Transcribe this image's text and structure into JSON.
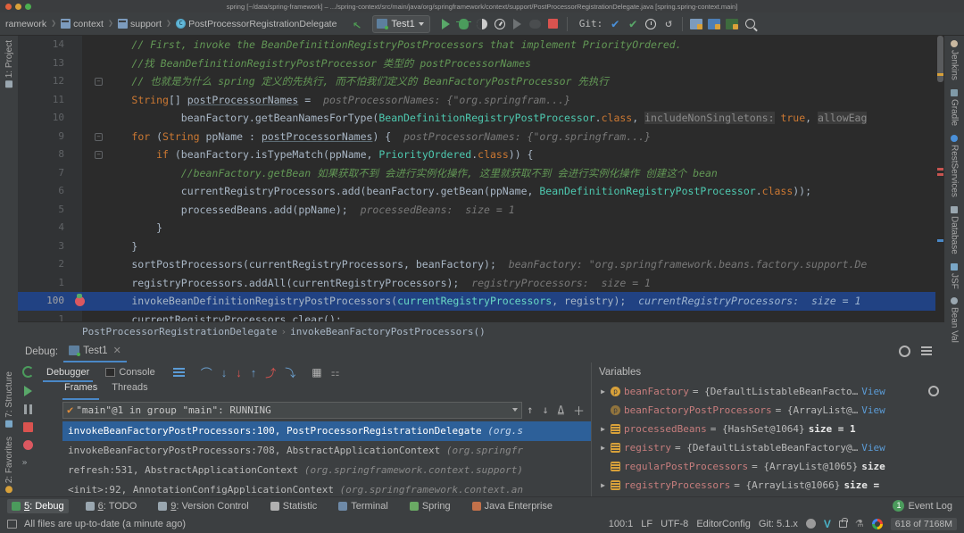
{
  "window": {
    "title": "spring [~/data/spring-framework] – .../spring-context/src/main/java/org/springframework/context/support/PostProcessorRegistrationDelegate.java [spring.spring-context.main]"
  },
  "toolbar": {
    "breadcrumbs": [
      {
        "label": "ramework",
        "icon": ""
      },
      {
        "label": "context",
        "icon": "folder-icon"
      },
      {
        "label": "support",
        "icon": "folder-icon"
      },
      {
        "label": "PostProcessorRegistrationDelegate",
        "icon": "class-icon"
      }
    ],
    "run_config": "Test1",
    "git_label": "Git:"
  },
  "rails": {
    "left": [
      "1: Project",
      "7: Structure",
      "2: Favorites"
    ],
    "right": [
      "Jenkins",
      "Gradle",
      "RestServices",
      "Database",
      "JSF",
      "Bean Val"
    ]
  },
  "editor": {
    "lines": [
      {
        "num": "14",
        "fold": false,
        "html": "        <c class=\"cmt\">// First, invoke the BeanDefinitionRegistryPostProcessors that implement PriorityOrdered.</c>"
      },
      {
        "num": "13",
        "fold": false,
        "html": "        <c class=\"cmt\">//找 BeanDefinitionRegistryPostProcessor 类型的 postProcessorNames</c>"
      },
      {
        "num": "12",
        "fold": true,
        "html": "        <c class=\"cmt\">// 也就是为什么 spring 定义的先执行, 而不怕我们定义的 BeanFactoryPostProcessor 先执行</c>"
      },
      {
        "num": "11",
        "fold": false,
        "html": "        <c class=\"kw\">String</c>[] <c class=\"und\">postProcessorNames</c> =  <c class=\"hint\">postProcessorNames: {\"org.springfram...}</c>"
      },
      {
        "num": "10",
        "fold": false,
        "html": "                beanFactory.getBeanNamesForType(<c class=\"cls\">BeanDefinitionRegistryPostProcessor</c>.<c class=\"kw\">class</c>, <c class=\"hintbg\">includeNonSingletons:</c> <c class=\"kw\">true</c>, <c class=\"hintbg\">allowEag</c>"
      },
      {
        "num": "9",
        "fold": true,
        "html": "        <c class=\"kw\">for</c> (<c class=\"kw\">String</c> ppName : <c class=\"und\">postProcessorNames</c>) {  <c class=\"hint\">postProcessorNames: {\"org.springfram...}</c>"
      },
      {
        "num": "8",
        "fold": true,
        "html": "            <c class=\"kw\">if</c> (beanFactory.isTypeMatch(ppName, <c class=\"cls\">PriorityOrdered</c>.<c class=\"kw\">class</c>)) {"
      },
      {
        "num": "7",
        "fold": false,
        "html": "                <c class=\"cmt\">//beanFactory.getBean 如果获取不到 会进行实例化操作, 这里就获取不到 会进行实例化操作 创建这个 bean</c>"
      },
      {
        "num": "6",
        "fold": false,
        "html": "                currentRegistryProcessors.add(beanFactory.getBean(ppName, <c class=\"cls\">BeanDefinitionRegistryPostProcessor</c>.<c class=\"kw\">class</c>));"
      },
      {
        "num": "5",
        "fold": false,
        "html": "                processedBeans.add(ppName);  <c class=\"hint\">processedBeans:  size = 1</c>"
      },
      {
        "num": "4",
        "fold": false,
        "html": "            }"
      },
      {
        "num": "3",
        "fold": false,
        "html": "        }"
      },
      {
        "num": "2",
        "fold": false,
        "html": "        sortPostProcessors(currentRegistryProcessors, beanFactory);  <c class=\"hint\">beanFactory: \"org.springframework.beans.factory.support.De</c>"
      },
      {
        "num": "1",
        "fold": false,
        "html": "        registryProcessors.addAll(currentRegistryProcessors);  <c class=\"hint\">registryProcessors:  size = 1</c>"
      },
      {
        "num": "100",
        "fold": false,
        "breakpoint": true,
        "highlight": true,
        "html": "        invokeBeanDefinitionRegistryPostProcessors(<c class=\"cls\">currentRegistryProcessors</c>, registry);  <c class=\"hint\">currentRegistryProcessors:  size = 1</c>"
      },
      {
        "num": "1",
        "fold": false,
        "html": "        currentRegistryProcessors.clear();"
      }
    ]
  },
  "breadcrumb_bar": {
    "class": "PostProcessorRegistrationDelegate",
    "separator": "›",
    "method": "invokeBeanFactoryPostProcessors()"
  },
  "debug": {
    "label": "Debug:",
    "tab": "Test1",
    "subtabs": [
      "Debugger",
      "Console"
    ],
    "frames_tabs": [
      "Frames",
      "Threads"
    ],
    "thread": "\"main\"@1 in group \"main\": RUNNING",
    "stack": [
      {
        "text": "invokeBeanFactoryPostProcessors:100, PostProcessorRegistrationDelegate ",
        "pkg": "(org.s",
        "selected": true
      },
      {
        "text": "invokeBeanFactoryPostProcessors:708, AbstractApplicationContext ",
        "pkg": "(org.springfr",
        "selected": false
      },
      {
        "text": "refresh:531, AbstractApplicationContext ",
        "pkg": "(org.springframework.context.support)",
        "selected": false
      },
      {
        "text": "<init>:92, AnnotationConfigApplicationContext ",
        "pkg": "(org.springframework.context.an",
        "selected": false
      }
    ],
    "variables_title": "Variables",
    "variables": [
      {
        "arrow": "▶",
        "icon": "p",
        "name": "beanFactory",
        "value": "= {DefaultListableBeanFacto…",
        "view": "View",
        "size": ""
      },
      {
        "arrow": "",
        "icon": "p-dim",
        "name": "beanFactoryPostProcessors",
        "value": "= {ArrayList@…",
        "view": "View",
        "size": ""
      },
      {
        "arrow": "▶",
        "icon": "l",
        "name": "processedBeans",
        "value": "= {HashSet@1064}",
        "view": "",
        "size": "size = 1"
      },
      {
        "arrow": "▶",
        "icon": "l",
        "name": "registry",
        "value": "= {DefaultListableBeanFactory@…",
        "view": "View",
        "size": ""
      },
      {
        "arrow": "",
        "icon": "l",
        "name": "regularPostProcessors",
        "value": "= {ArrayList@1065}",
        "view": "",
        "size": "size"
      },
      {
        "arrow": "▶",
        "icon": "l",
        "name": "registryProcessors",
        "value": "= {ArrayList@1066}",
        "view": "",
        "size": "size ="
      }
    ]
  },
  "bottom_tabs": [
    {
      "num": "5",
      "label": ": Debug",
      "icon": "bug-icon",
      "active": true
    },
    {
      "num": "6",
      "label": ": TODO",
      "icon": "list-icon",
      "active": false
    },
    {
      "num": "9",
      "label": ": Version Control",
      "icon": "branch-icon",
      "active": false
    },
    {
      "num": "",
      "label": "Statistic",
      "icon": "pie-icon",
      "active": false
    },
    {
      "num": "",
      "label": "Terminal",
      "icon": "terminal-icon",
      "active": false
    },
    {
      "num": "",
      "label": "Spring",
      "icon": "leaf-icon",
      "active": false
    },
    {
      "num": "",
      "label": "Java Enterprise",
      "icon": "jee-icon",
      "active": false
    }
  ],
  "event_log": {
    "count": "1",
    "label": "Event Log"
  },
  "status": {
    "message": "All files are up-to-date (a minute ago)",
    "caret": "100:1",
    "line_sep": "LF",
    "encoding": "UTF-8",
    "editorconfig": "EditorConfig",
    "git_branch": "Git: 5.1.x",
    "memory": "618 of 7168M"
  }
}
